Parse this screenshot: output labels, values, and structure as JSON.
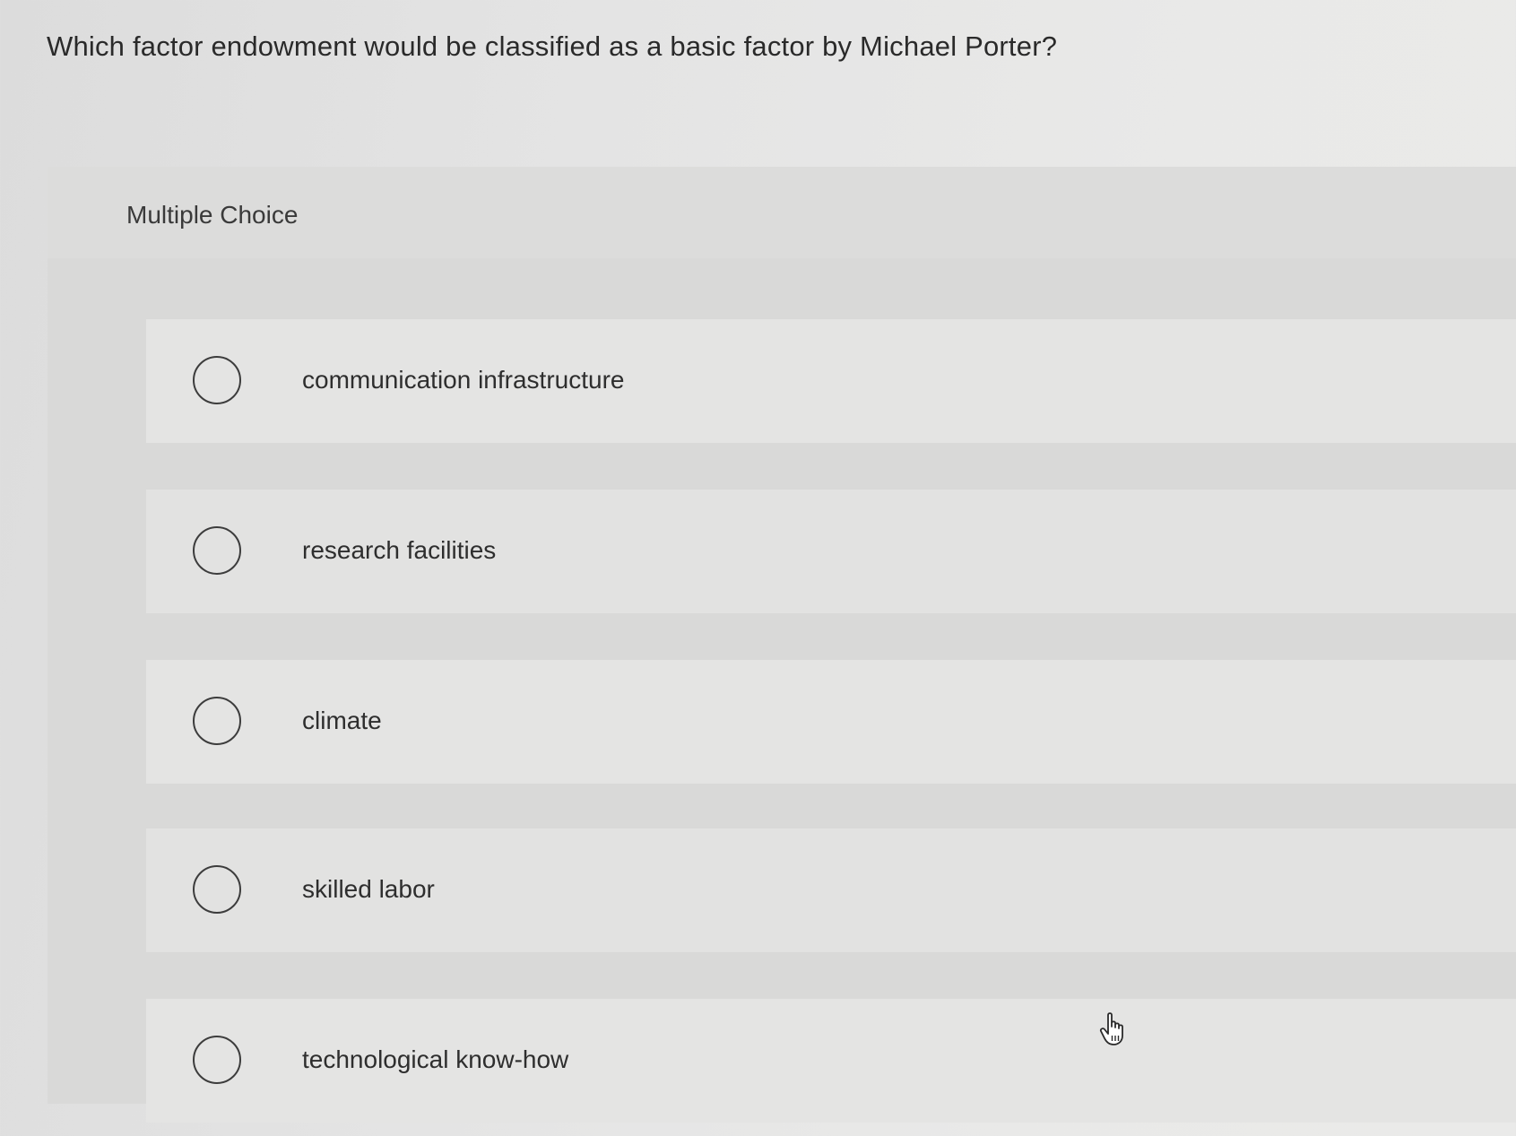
{
  "question": {
    "text": "Which factor endowment would be classified as a basic factor by Michael Porter?"
  },
  "panel": {
    "type_label": "Multiple Choice"
  },
  "options": [
    {
      "label": "communication infrastructure",
      "selected": false
    },
    {
      "label": "research facilities",
      "selected": false
    },
    {
      "label": "climate",
      "selected": false
    },
    {
      "label": "skilled labor",
      "selected": false
    },
    {
      "label": "technological know-how",
      "selected": false
    }
  ],
  "cursor": {
    "icon": "hand-pointer-icon"
  }
}
